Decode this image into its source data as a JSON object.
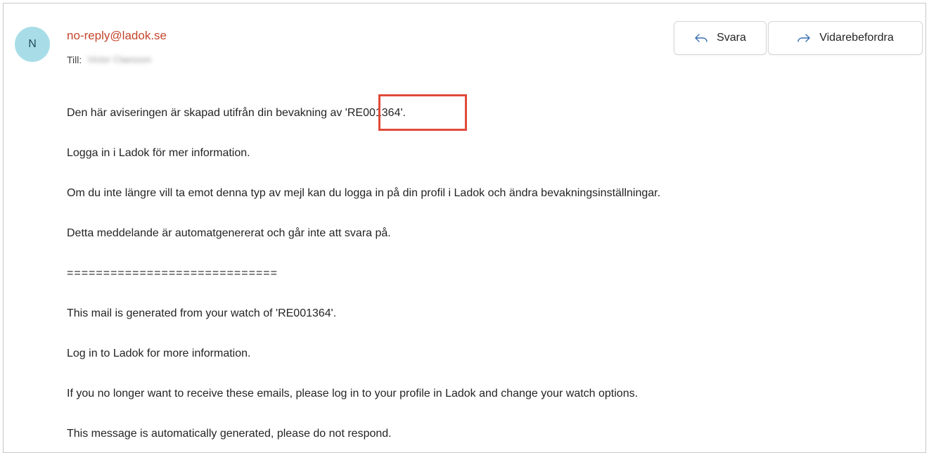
{
  "email": {
    "avatar_initial": "N",
    "sender": "no-reply@ladok.se",
    "to_label": "Till:",
    "to_name": "Victor Claesson",
    "actions": {
      "reply_label": "Svara",
      "forward_label": "Vidarebefordra"
    },
    "body": {
      "line1_prefix": "Den här aviseringen är skapad utifrån din bevakning av ",
      "line1_code": "'RE001364'.",
      "line2": "Logga in i Ladok för mer information.",
      "line3": "Om du inte längre vill ta emot denna typ av mejl kan du logga in på din profil i Ladok och ändra bevakningsinställningar.",
      "line4": "Detta meddelande är automatgenererat och går inte att svara på.",
      "separator": "=============================",
      "line5": "This mail is generated from your watch of 'RE001364'.",
      "line6": "Log in to Ladok for more information.",
      "line7": "If you no longer want to receive these emails, please log in to your profile in Ladok and change your watch options.",
      "line8": "This message is automatically generated, please do not respond."
    },
    "highlight_color": "#e04a3a",
    "sender_color": "#c4452d",
    "avatar_color": "#a8dde8"
  }
}
